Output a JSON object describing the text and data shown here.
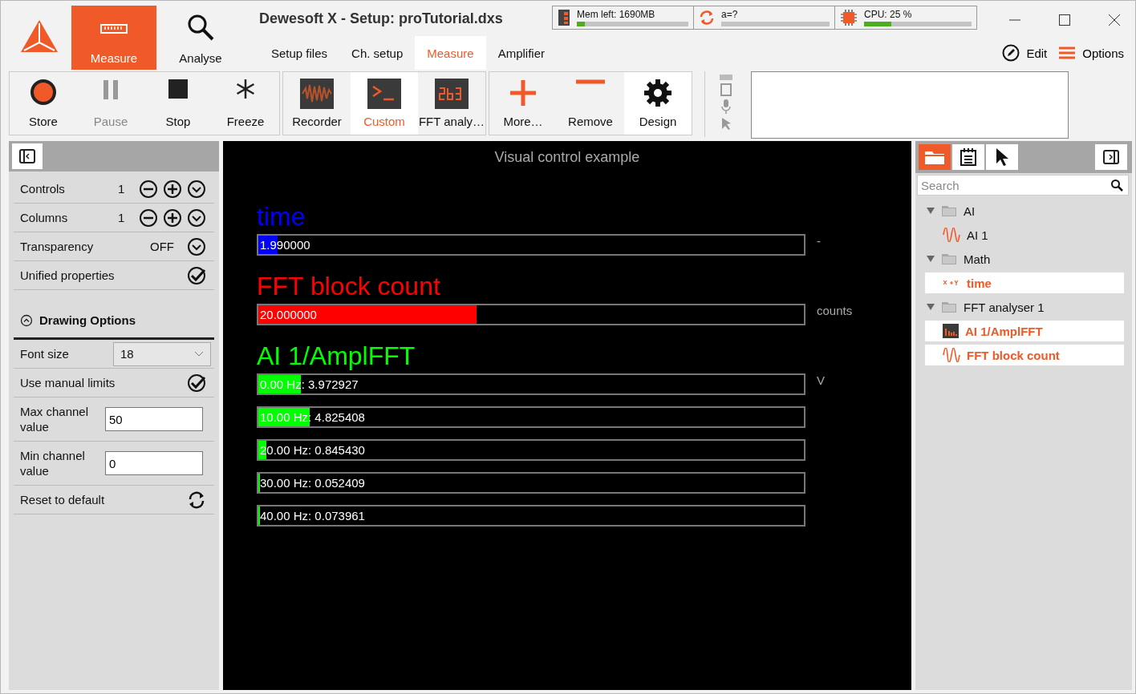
{
  "window": {
    "title": "Dewesoft X - Setup: proTutorial.dxs"
  },
  "modes": [
    {
      "label": "Measure",
      "kind": "ruler",
      "selected": true
    },
    {
      "label": "Analyse",
      "kind": "search",
      "selected": false
    }
  ],
  "meters": [
    {
      "kind": "memory",
      "text": "Mem left: 1690MB",
      "level": 0.07
    },
    {
      "kind": "sync",
      "text": "a=?"
    },
    {
      "kind": "cpu",
      "text": "CPU: 25 %",
      "level": 0.25
    }
  ],
  "tabs": [
    {
      "label": "Setup files",
      "selected": false
    },
    {
      "label": "Ch. setup",
      "selected": false
    },
    {
      "label": "Measure",
      "selected": true
    },
    {
      "label": "Amplifier",
      "selected": false
    }
  ],
  "header_actions": [
    {
      "label": "Edit",
      "kind": "edit"
    },
    {
      "label": "Options",
      "kind": "menu"
    }
  ],
  "toolbar_groups": [
    [
      {
        "label": "Store",
        "kind": "record",
        "disabled": false,
        "selected": false,
        "highlighted": false
      },
      {
        "label": "Pause",
        "kind": "pause",
        "disabled": true,
        "selected": false,
        "highlighted": false
      },
      {
        "label": "Stop",
        "kind": "stop",
        "disabled": false,
        "selected": false,
        "highlighted": false
      },
      {
        "label": "Freeze",
        "kind": "freeze",
        "disabled": false,
        "selected": false,
        "highlighted": false
      }
    ],
    [
      {
        "label": "Recorder",
        "kind": "recorder",
        "disabled": false,
        "selected": false,
        "highlighted": false
      },
      {
        "label": "Custom",
        "kind": "terminal",
        "disabled": false,
        "selected": true,
        "highlighted": true
      },
      {
        "label": "FFT analy…",
        "kind": "display",
        "disabled": false,
        "selected": false,
        "highlighted": false
      }
    ],
    [
      {
        "label": "More…",
        "kind": "plus",
        "disabled": false,
        "selected": false,
        "highlighted": false
      },
      {
        "label": "Remove",
        "kind": "minus",
        "disabled": false,
        "selected": false,
        "highlighted": false
      },
      {
        "label": "Design",
        "kind": "gear",
        "disabled": false,
        "selected": false,
        "highlighted": true
      }
    ]
  ],
  "properties": [
    {
      "kind": "stepper",
      "label": "Controls",
      "value": "1"
    },
    {
      "kind": "dropdown_stepper",
      "label": "Columns",
      "value": "1"
    },
    {
      "kind": "dropdown",
      "label": "Transparency",
      "value": "OFF"
    },
    {
      "kind": "check",
      "label": "Unified properties",
      "checked": true
    }
  ],
  "drawing_options": {
    "title": "Drawing Options",
    "expanded": true,
    "rows": [
      {
        "kind": "select",
        "label": "Font size",
        "value": "18"
      },
      {
        "kind": "check",
        "label": "Use manual limits",
        "checked": true
      },
      {
        "kind": "input",
        "label": "Max channel value",
        "value": "50"
      },
      {
        "kind": "input",
        "label": "Min channel value",
        "value": "0"
      },
      {
        "kind": "action",
        "label": "Reset to default"
      }
    ]
  },
  "display": {
    "title": "Visual control example",
    "channels": [
      {
        "name": "time",
        "color": "#0000ff",
        "unit": "-",
        "bars": [
          {
            "text": "1.990000",
            "level": 0.035
          }
        ]
      },
      {
        "name": "FFT block count",
        "color": "#ff0000",
        "unit": "counts",
        "bars": [
          {
            "text": "20.000000",
            "level": 0.4
          }
        ]
      },
      {
        "name": "AI 1/AmplFFT",
        "color": "#00ff00",
        "unit": "V",
        "bars": [
          {
            "text": "0.00 Hz: 3.972927",
            "level": 0.078
          },
          {
            "text": "10.00 Hz: 4.825408",
            "level": 0.094
          },
          {
            "text": "20.00 Hz: 0.845430",
            "level": 0.015
          },
          {
            "text": "30.00 Hz: 0.052409",
            "level": 0.003
          },
          {
            "text": "40.00 Hz: 0.073961",
            "level": 0.002
          }
        ]
      }
    ]
  },
  "channel_panel": {
    "search": {
      "placeholder": "Search"
    },
    "tree": [
      {
        "label": "AI",
        "kind": "folder",
        "selected": false,
        "expanded": true,
        "children": [
          {
            "label": "AI 1",
            "kind": "wave",
            "selected": false
          }
        ]
      },
      {
        "label": "Math",
        "kind": "folder",
        "selected": false,
        "expanded": true,
        "children": [
          {
            "label": "time",
            "kind": "formula",
            "selected": true
          }
        ]
      },
      {
        "label": "FFT analyser 1",
        "kind": "folder",
        "selected": false,
        "expanded": true,
        "children": [
          {
            "label": "AI 1/AmplFFT",
            "kind": "spectrum",
            "selected": true
          },
          {
            "label": "FFT block count",
            "kind": "wave",
            "selected": true
          }
        ]
      }
    ]
  }
}
